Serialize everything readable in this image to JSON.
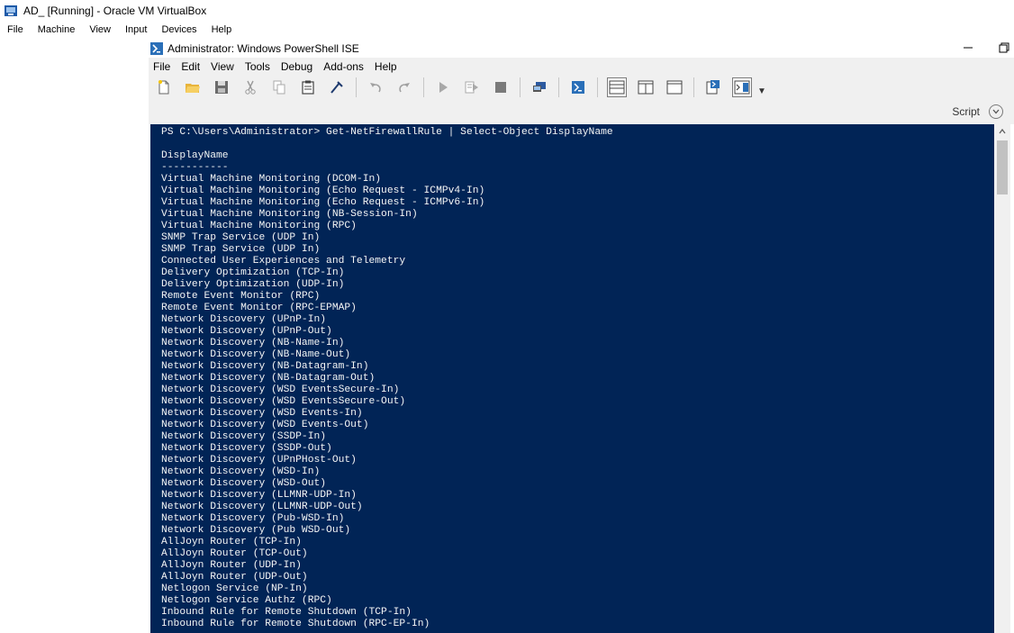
{
  "vbox": {
    "title": "AD_ [Running] - Oracle VM VirtualBox",
    "menu": [
      "File",
      "Machine",
      "View",
      "Input",
      "Devices",
      "Help"
    ]
  },
  "ise": {
    "title": "Administrator: Windows PowerShell ISE",
    "menu": [
      "File",
      "Edit",
      "View",
      "Tools",
      "Debug",
      "Add-ons",
      "Help"
    ],
    "toolbar_icons": [
      "new-file-icon",
      "open-folder-icon",
      "save-icon",
      "cut-icon",
      "copy-icon",
      "paste-icon",
      "clear-console-icon",
      "undo-icon",
      "redo-icon",
      "run-icon",
      "run-selection-icon",
      "stop-icon",
      "new-remote-tab-icon",
      "start-powershell-icon",
      "show-script-top-icon",
      "show-script-right-icon",
      "show-script-maximized-icon",
      "show-command-window-icon",
      "show-command-addon-icon"
    ],
    "script_label": "Script",
    "colors": {
      "console_bg": "#012456",
      "console_fg": "#f5f5f5"
    }
  },
  "console": {
    "lines": [
      "PS C:\\Users\\Administrator> Get-NetFirewallRule | Select-Object DisplayName",
      "",
      "DisplayName",
      "-----------",
      "Virtual Machine Monitoring (DCOM-In)",
      "Virtual Machine Monitoring (Echo Request - ICMPv4-In)",
      "Virtual Machine Monitoring (Echo Request - ICMPv6-In)",
      "Virtual Machine Monitoring (NB-Session-In)",
      "Virtual Machine Monitoring (RPC)",
      "SNMP Trap Service (UDP In)",
      "SNMP Trap Service (UDP In)",
      "Connected User Experiences and Telemetry",
      "Delivery Optimization (TCP-In)",
      "Delivery Optimization (UDP-In)",
      "Remote Event Monitor (RPC)",
      "Remote Event Monitor (RPC-EPMAP)",
      "Network Discovery (UPnP-In)",
      "Network Discovery (UPnP-Out)",
      "Network Discovery (NB-Name-In)",
      "Network Discovery (NB-Name-Out)",
      "Network Discovery (NB-Datagram-In)",
      "Network Discovery (NB-Datagram-Out)",
      "Network Discovery (WSD EventsSecure-In)",
      "Network Discovery (WSD EventsSecure-Out)",
      "Network Discovery (WSD Events-In)",
      "Network Discovery (WSD Events-Out)",
      "Network Discovery (SSDP-In)",
      "Network Discovery (SSDP-Out)",
      "Network Discovery (UPnPHost-Out)",
      "Network Discovery (WSD-In)",
      "Network Discovery (WSD-Out)",
      "Network Discovery (LLMNR-UDP-In)",
      "Network Discovery (LLMNR-UDP-Out)",
      "Network Discovery (Pub-WSD-In)",
      "Network Discovery (Pub WSD-Out)",
      "AllJoyn Router (TCP-In)",
      "AllJoyn Router (TCP-Out)",
      "AllJoyn Router (UDP-In)",
      "AllJoyn Router (UDP-Out)",
      "Netlogon Service (NP-In)",
      "Netlogon Service Authz (RPC)",
      "Inbound Rule for Remote Shutdown (TCP-In)",
      "Inbound Rule for Remote Shutdown (RPC-EP-In)"
    ]
  }
}
